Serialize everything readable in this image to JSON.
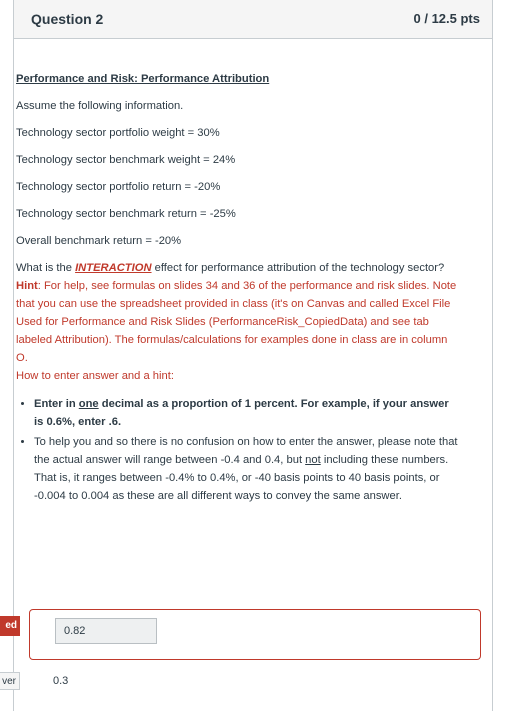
{
  "question": {
    "title": "Question 2",
    "points": "0 / 12.5 pts"
  },
  "content": {
    "heading": "Performance and Risk: Performance Attribution",
    "intro": "Assume the following information.",
    "facts": [
      "Technology sector portfolio weight = 30%",
      "Technology sector benchmark weight = 24%",
      "Technology sector portfolio return = -20%",
      "Technology sector benchmark return = -25%",
      "Overall benchmark return = -20%"
    ],
    "question_pre": "What is the ",
    "question_emph": "INTERACTION",
    "question_post": " effect for performance attribution of the technology sector?",
    "hint_label": "Hint",
    "hint_text": ": For help, see formulas on slides 34 and 36 of the performance and risk slides. Note that you can use the spreadsheet provided in class (it's on Canvas and called Excel File Used for Performance and Risk Slides (PerformanceRisk_CopiedData) and see tab labeled Attribution). The formulas/calculations for examples done in class are in column O.",
    "howto_heading": "How to enter answer and a hint:",
    "bullet1_a": "Enter in ",
    "bullet1_u": "one",
    "bullet1_b": " decimal as a proportion of 1 percent. For example, if your answer is 0.6%, enter .6.",
    "bullet2_a": "To help you and so there is no confusion on how to enter the answer, please note that the actual answer will range between -0.4 and 0.4, but ",
    "bullet2_u": "not",
    "bullet2_b": " including these numbers. That is, it ranges between -0.4% to 0.4%, or -40 basis points to 40 basis points, or -0.004 to 0.004 as these are all different ways to convey the same answer."
  },
  "answer": {
    "user_value": "0.82",
    "incorrect_tag": "ed",
    "correct_tag": "ver",
    "correct_value": "0.3"
  },
  "colors": {
    "accent_red": "#c0392b",
    "text": "#2d3b45",
    "header_bg": "#f5f5f5"
  }
}
